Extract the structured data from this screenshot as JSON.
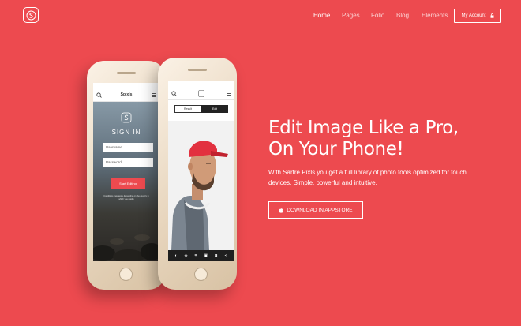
{
  "header": {
    "logo_icon": "sartre-s-logo-icon",
    "nav": [
      {
        "label": "Home",
        "active": true
      },
      {
        "label": "Pages",
        "active": false
      },
      {
        "label": "Folio",
        "active": false
      },
      {
        "label": "Blog",
        "active": false
      },
      {
        "label": "Elements",
        "active": false
      }
    ],
    "account_label": "My Account",
    "account_icon": "lock-icon"
  },
  "hero": {
    "title_line1": "Edit Image Like a Pro,",
    "title_line2": "On Your Phone!",
    "description": "With Sartre Pixls you get a full library of photo tools optimized for touch devices. Simple, powerful and intuitive.",
    "download_label": "DOWNLOAD IN APPSTORE",
    "download_icon": "apple-icon"
  },
  "phone_left": {
    "app_title": "Spixls",
    "signin_title": "SIGN IN",
    "username_placeholder": "Username",
    "password_placeholder": "Password",
    "start_label": "Start Editing",
    "note": "Conditions may apply depending on the country in which you reside"
  },
  "phone_right": {
    "seg_left": "Result",
    "seg_right": "Edit"
  },
  "colors": {
    "background": "#ed4a4f",
    "accent": "#ed4a4f",
    "text": "#ffffff"
  }
}
